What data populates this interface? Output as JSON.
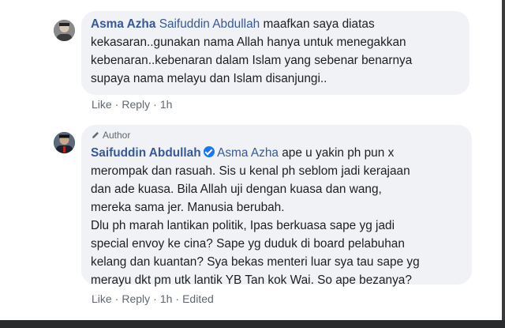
{
  "comments": [
    {
      "author": "Asma Azha",
      "mention": "Saifuddin Abdullah",
      "lines": [
        " maafkan saya diatas",
        "kekasaran..gunakan nama Allah hanya untuk menegakkan",
        "kebenaran..kebenaran dalam Islam yang sebenar benarnya",
        "supaya nama melayu dan Islam disanjungi.."
      ],
      "actions": {
        "like": "Like",
        "reply": "Reply",
        "time": "1h"
      }
    },
    {
      "badge": "Author",
      "author": "Saifuddin Abdullah",
      "mention": "Asma Azha",
      "lines": [
        " ape u yakin ph pun x",
        "merompak dan rasuah. Sis u kenal ph seblom jadi kerajaan",
        "dan ade kuasa. Bila Allah uji dengan kuasa dan wang,",
        "mereka sama jer. Manusia berubah.",
        "Dlu ph marah lantikan politik, Ipas berkuasa sape yg jadi",
        "special envoy ke cina? Sape yg duduk di board pelabuhan",
        "kelang dan kuantan? Sya bekas menteri luar sya tau sape yg",
        "merayu dkt pm utk lantik YB Tan kok Wai. So ape bezanya?"
      ],
      "actions": {
        "like": "Like",
        "reply": "Reply",
        "time": "1h",
        "edited": "Edited"
      }
    }
  ],
  "separator": "·",
  "icons": {
    "avatar1": "user-avatar",
    "avatar2": "user-avatar",
    "author_badge": "pencil-icon",
    "verified": "verified-badge-icon"
  },
  "colors": {
    "link_name": "#385898",
    "bubble_bg": "#f0f2f5",
    "meta": "#606770",
    "verified": "#1877f2"
  }
}
